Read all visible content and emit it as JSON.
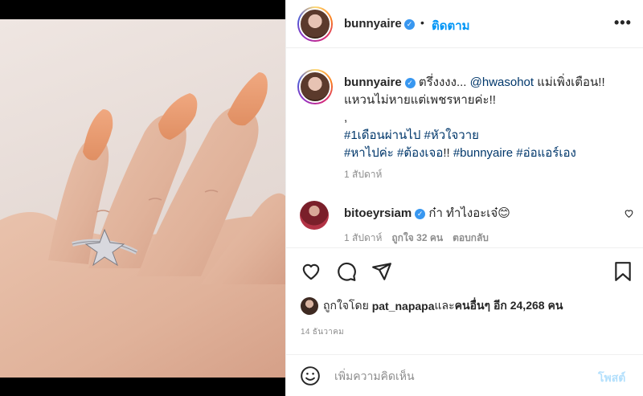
{
  "post": {
    "username": "bunnyaire",
    "verified": true,
    "follow_label": "ติดตาม",
    "dot": "•",
    "more_icon": "more-options-icon"
  },
  "caption": {
    "username": "bunnyaire",
    "text_line1_a": " ตรึ่งงงง... ",
    "mention": "@hwasohot",
    "text_line1_b": " แม่เพิ่งเตือน!!",
    "text_line2": "แหวนไม่หายแต่เพชรหายค่ะ!!",
    "text_line3": ",",
    "hashtags_line1": [
      "#1เดือนผ่านไป",
      "#หัวใจวาย"
    ],
    "hashtags_line2_a": "#หาไปค่ะ",
    "hashtags_line2_b": "#ต้องเจอ",
    "hashtags_line2_c": "!! ",
    "hashtags_line2_d": "#bunnyaire",
    "hashtags_line2_e": "#อ่อแอร์เอง",
    "time": "1 สัปดาห์"
  },
  "comment": {
    "username": "bitoeyrsiam",
    "text": " ก๋า ทำไงอะเจ๋😊",
    "time": "1 สัปดาห์",
    "likes": "ถูกใจ 32 คน",
    "reply": "ตอบกลับ"
  },
  "likes": {
    "prefix": "ถูกใจโดย ",
    "user": "pat_napapa",
    "middle": " และ ",
    "others": "คนอื่นๆ อีก 24,268 คน"
  },
  "date": "14 ธันวาคม",
  "comment_box": {
    "placeholder": "เพิ่มความคิดเห็น",
    "post_label": "โพสต์"
  },
  "colors": {
    "accent": "#0095f6",
    "link": "#00376b",
    "muted": "#8e8e8e",
    "nail": "#e89a70"
  }
}
